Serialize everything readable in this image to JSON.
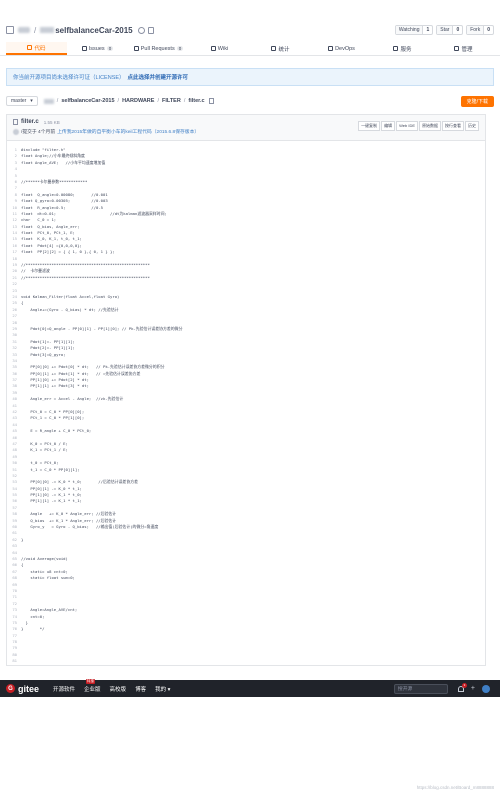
{
  "repo": {
    "name_suffix": "selfbalanceCar-2015",
    "watch_label": "Watching",
    "watch_count": "1",
    "star_label": "Star",
    "star_count": "0",
    "fork_label": "Fork",
    "fork_count": "0"
  },
  "tabs": [
    {
      "label": "代码"
    },
    {
      "label": "Issues",
      "badge": "0"
    },
    {
      "label": "Pull Requests",
      "badge": "0"
    },
    {
      "label": "Wiki"
    },
    {
      "label": "统计"
    },
    {
      "label": "DevOps"
    },
    {
      "label": "服务"
    },
    {
      "label": "管理"
    }
  ],
  "notice": {
    "text": "你当前开源项目尚未选择许可证（LICENSE）",
    "link": "点此选择并创建开源许可"
  },
  "path": {
    "branch": "master",
    "segments": [
      "selfbalanceCar-2015",
      "HARDWARE",
      "FILTER",
      "filter.c"
    ],
    "clone_label": "克隆/下载"
  },
  "file": {
    "name": "filter.c",
    "size": "1.55 KB",
    "commit_author": "/提交于 4个月前",
    "commit_message": "上传我2015年做的自平衡小车的keil工程代码（2015.6.8保存版本）",
    "actions": [
      "一键复制",
      "编辑",
      "Web IDE",
      "原始数据",
      "按行查看",
      "历史"
    ]
  },
  "code_lines": [
    "#include \"filter.h\"",
    "float Angle;//小车最终倾斜角度",
    "float Angle_AVE;   //小车平均速度增加值",
    "",
    "",
    "//******卡尔曼参数************",
    "",
    "float  Q_angle=0.00080;       //0.001",
    "float Q_gyro=0.00305;         //0.003",
    "float  R_angle=0.5;           //0.5",
    "float  dt=0.01;                       //dt为kalman滤波器采样时间;",
    "char   C_0 = 1;",
    "float  Q_bias, Angle_err;",
    "float  PCt_0, PCt_1, E;",
    "float  K_0, K_1, t_0, t_1;",
    "float  Pdot[4] ={0,0,0,0};",
    "float  PP[2][2] = { { 1, 0 },{ 0, 1 } };",
    "",
    "//*****************************************************",
    "//  卡尔曼滤波",
    "//*****************************************************",
    "",
    "",
    "void Kalman_Filter(float Accel,float Gyro)",
    "{",
    "    Angle+=(Gyro - Q_bias) * dt; //先验估计",
    "",
    "",
    "    Pdot[0]=Q_angle - PP[0][1] - PP[1][0]; // Pk-先验估计误差协方差的微分",
    "",
    "    Pdot[1]=- PP[1][1];",
    "    Pdot[2]=- PP[1][1];",
    "    Pdot[3]=Q_gyro;",
    "",
    "    PP[0][0] += Pdot[0] * dt;   // Pk-先验估计误差协方差微分的积分",
    "    PP[0][1] += Pdot[1] * dt;   // =先验估计误差协方差",
    "    PP[1][0] += Pdot[2] * dt;",
    "    PP[1][1] += Pdot[3] * dt;",
    "",
    "    Angle_err = Accel - Angle;  //zk-先验估计",
    "",
    "    PCt_0 = C_0 * PP[0][0];",
    "    PCt_1 = C_0 * PP[1][0];",
    "",
    "    E = R_angle + C_0 * PCt_0;",
    "",
    "    K_0 = PCt_0 / E;",
    "    K_1 = PCt_1 / E;",
    "",
    "    t_0 = PCt_0;",
    "    t_1 = C_0 * PP[0][1];",
    "",
    "    PP[0][0] -= K_0 * t_0;       //后验估计误差协方差",
    "    PP[0][1] -= K_0 * t_1;",
    "    PP[1][0] -= K_1 * t_0;",
    "    PP[1][1] -= K_1 * t_1;",
    "",
    "    Angle   += K_0 * Angle_err; //后验估计",
    "    Q_bias  += K_1 * Angle_err; //后验估计",
    "    Gyro_y   = Gyro - Q_bias;   //输出值(后验估计)的微分=角速度",
    "",
    "}",
    "",
    "",
    "//void Average(void)",
    "{",
    "    static u8 cnt=0;",
    "    static float sum=0;",
    "",
    "",
    "",
    "",
    "    Angle=Angle_AVE/cnt;",
    "    cnt=0;",
    "  }",
    "}       */",
    "",
    "",
    "",
    "",
    ""
  ],
  "gitee": {
    "logo": "gitee",
    "nav": [
      "开源软件",
      "企业版",
      "高校版",
      "博客",
      "我的"
    ],
    "hot": "特惠",
    "search_placeholder": "搜开源",
    "notif_count": "3"
  },
  "watermark": "https://blog.csdn.net/Board_m8888888"
}
